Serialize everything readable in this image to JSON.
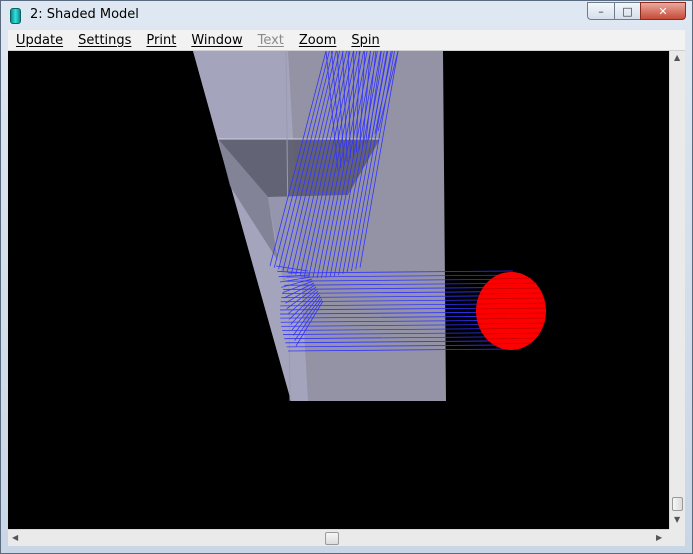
{
  "window": {
    "title": "2: Shaded Model",
    "controls": {
      "minimize": "–",
      "maximize": "□",
      "close": "✕"
    }
  },
  "menu": {
    "items": [
      {
        "label": "Update",
        "enabled": true
      },
      {
        "label": "Settings",
        "enabled": true
      },
      {
        "label": "Print",
        "enabled": true
      },
      {
        "label": "Window",
        "enabled": true
      },
      {
        "label": "Text",
        "enabled": false
      },
      {
        "label": "Zoom",
        "enabled": true
      },
      {
        "label": "Spin",
        "enabled": true
      }
    ]
  },
  "viewport": {
    "background": "#000000",
    "solid_color": "#c8c8dc",
    "wireframe_color": "#3333ff",
    "sphere_color": "#ff0000",
    "sphere_line_color": "#aa0000"
  },
  "scrollbars": {
    "up_arrow": "▲",
    "down_arrow": "▼",
    "left_arrow": "◀",
    "right_arrow": "▶"
  }
}
